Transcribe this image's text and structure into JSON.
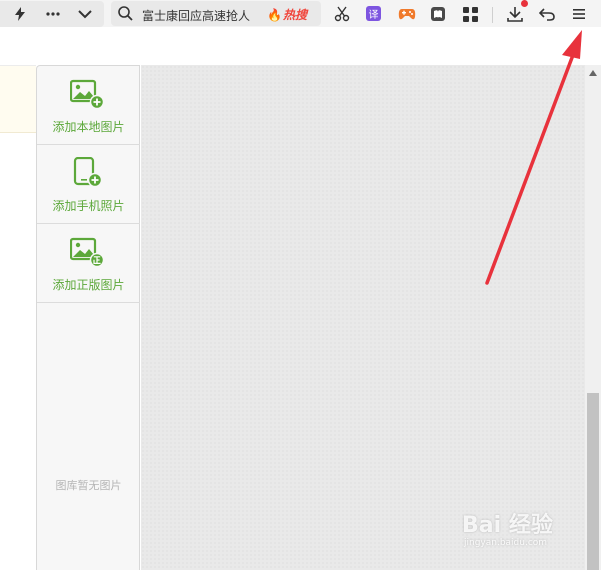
{
  "toolbar": {
    "search_text": "富士康回应高速抢人",
    "hot_label": "热搜",
    "translate_label": "译"
  },
  "picker": {
    "items": [
      {
        "label": "添加本地图片",
        "icon": "add-local-image-icon"
      },
      {
        "label": "添加手机照片",
        "icon": "add-phone-photo-icon"
      },
      {
        "label": "添加正版图片",
        "icon": "add-licensed-image-icon"
      }
    ],
    "empty_text": "图库暂无图片"
  },
  "watermark": {
    "brand": "Bai 经验",
    "sub": "jingyan.baidu.com"
  },
  "colors": {
    "accent_green": "#5ca83a",
    "arrow_red": "#e8323c",
    "hot_red": "#f0463c",
    "translate_purple": "#7d55e0"
  }
}
